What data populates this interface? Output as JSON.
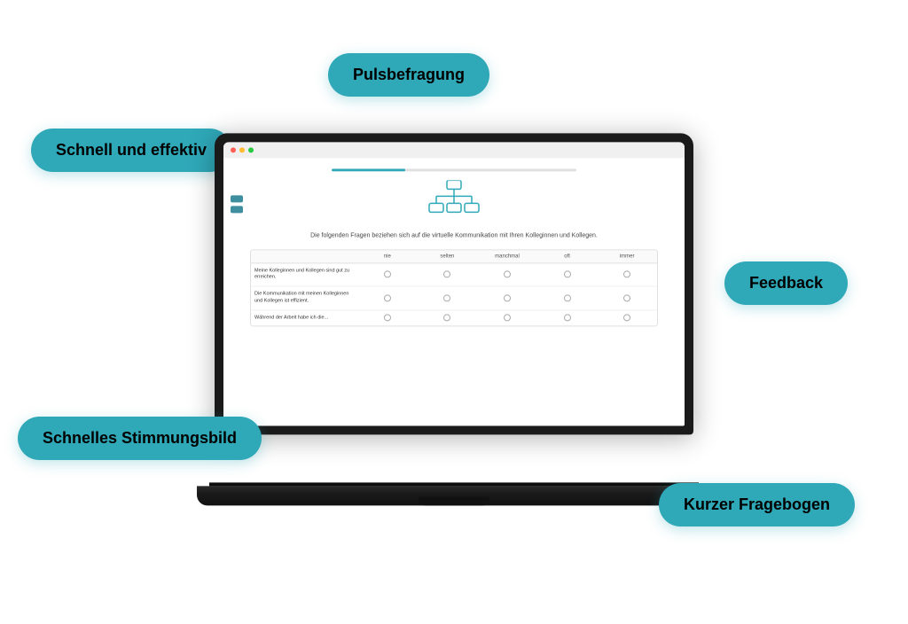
{
  "bubbles": {
    "schnell_effektiv": "Schnell und effektiv",
    "pulsbefragung": "Pulsbefragung",
    "feedback": "Feedback",
    "stimmungsbild": "Schnelles Stimmungsbild",
    "fragebogen": "Kurzer Fragebogen"
  },
  "screen": {
    "description": "Die folgenden Fragen beziehen sich auf die virtuelle Kommunikation mit Ihren Kolleginnen und Kollegen.",
    "survey_headers": [
      "",
      "nie",
      "selten",
      "manchmal",
      "oft",
      "immer"
    ],
    "survey_rows": [
      {
        "label": "Meine Kolleginnen und Kollegen sind gut zu erreichen.",
        "radios": [
          false,
          false,
          false,
          false,
          false
        ]
      },
      {
        "label": "Die Kommunikation mit meinen Kolleginnen und Kollegen ist effizient.",
        "radios": [
          false,
          false,
          false,
          false,
          false
        ]
      },
      {
        "label": "Während der Arbeit habe ich die...",
        "radios": [
          false,
          false,
          false,
          false,
          false
        ]
      }
    ]
  }
}
